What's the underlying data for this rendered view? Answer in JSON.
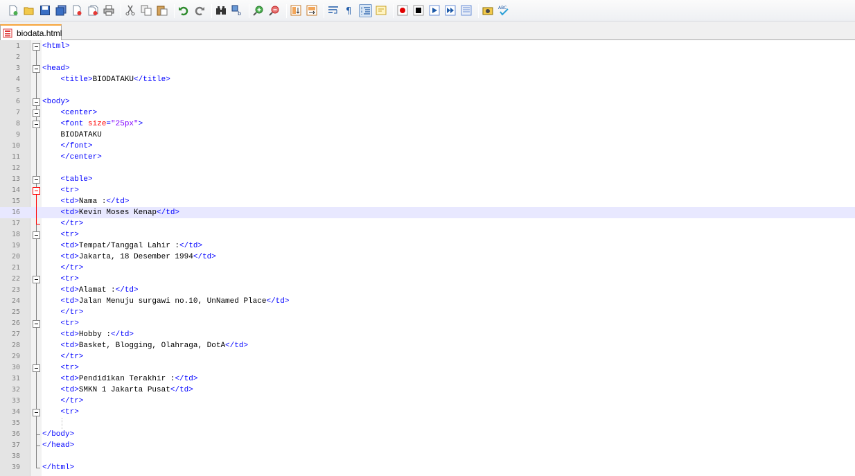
{
  "toolbar": {
    "buttons": [
      {
        "name": "new-file-icon"
      },
      {
        "name": "open-file-icon"
      },
      {
        "name": "save-icon"
      },
      {
        "name": "save-all-icon"
      },
      {
        "name": "close-icon"
      },
      {
        "name": "close-all-icon"
      },
      {
        "name": "print-icon"
      },
      {
        "name": "cut-icon"
      },
      {
        "name": "copy-icon"
      },
      {
        "name": "paste-icon"
      },
      {
        "name": "undo-icon"
      },
      {
        "name": "redo-icon"
      },
      {
        "name": "find-icon"
      },
      {
        "name": "replace-icon"
      },
      {
        "name": "zoom-in-icon"
      },
      {
        "name": "zoom-out-icon"
      },
      {
        "name": "sync-vertical-icon"
      },
      {
        "name": "sync-horizontal-icon"
      },
      {
        "name": "word-wrap-icon"
      },
      {
        "name": "show-all-characters-icon"
      },
      {
        "name": "indent-guide-icon",
        "active": true
      },
      {
        "name": "user-language-icon"
      },
      {
        "name": "record-macro-icon"
      },
      {
        "name": "stop-recording-icon"
      },
      {
        "name": "play-macro-icon"
      },
      {
        "name": "run-macro-multiple-icon"
      },
      {
        "name": "save-macro-icon"
      },
      {
        "name": "launch-browser-icon"
      },
      {
        "name": "spell-check-icon",
        "label": "ABC"
      }
    ]
  },
  "tab": {
    "label": "biodata.html",
    "icon": "unsaved-file-icon"
  },
  "colors": {
    "tag": "#0000ff",
    "attribute": "#ff0000",
    "value": "#8000ff",
    "text": "#000000",
    "current_line": "#e8e8ff",
    "tab_accent": "#f7a53a"
  },
  "editor": {
    "current_line": 16,
    "lines": [
      {
        "n": "1",
        "parts": [
          [
            "tag",
            "<html>"
          ]
        ]
      },
      {
        "n": "2",
        "parts": []
      },
      {
        "n": "3",
        "parts": [
          [
            "tag",
            "<head>"
          ]
        ]
      },
      {
        "n": "4",
        "parts": [
          [
            "txt",
            "    "
          ],
          [
            "tag",
            "<title>"
          ],
          [
            "txt",
            "BIODATAKU"
          ],
          [
            "tag",
            "</title>"
          ]
        ]
      },
      {
        "n": "5",
        "parts": []
      },
      {
        "n": "6",
        "parts": [
          [
            "tag",
            "<body>"
          ]
        ]
      },
      {
        "n": "7",
        "parts": [
          [
            "txt",
            "    "
          ],
          [
            "tag",
            "<center>"
          ]
        ]
      },
      {
        "n": "8",
        "parts": [
          [
            "txt",
            "    "
          ],
          [
            "tag",
            "<font "
          ],
          [
            "attr",
            "size"
          ],
          [
            "tag",
            "="
          ],
          [
            "val",
            "\"25px\""
          ],
          [
            "tag",
            ">"
          ]
        ]
      },
      {
        "n": "9",
        "parts": [
          [
            "txt",
            "    BIODATAKU"
          ]
        ]
      },
      {
        "n": "10",
        "parts": [
          [
            "txt",
            "    "
          ],
          [
            "tag",
            "</font>"
          ]
        ]
      },
      {
        "n": "11",
        "parts": [
          [
            "txt",
            "    "
          ],
          [
            "tag",
            "</center>"
          ]
        ]
      },
      {
        "n": "12",
        "parts": []
      },
      {
        "n": "13",
        "parts": [
          [
            "txt",
            "    "
          ],
          [
            "tag",
            "<table>"
          ]
        ]
      },
      {
        "n": "14",
        "parts": [
          [
            "txt",
            "    "
          ],
          [
            "tag",
            "<tr>"
          ]
        ]
      },
      {
        "n": "15",
        "parts": [
          [
            "txt",
            "    "
          ],
          [
            "tag",
            "<td>"
          ],
          [
            "txt",
            "Nama :"
          ],
          [
            "tag",
            "</td>"
          ]
        ]
      },
      {
        "n": "16",
        "parts": [
          [
            "txt",
            "    "
          ],
          [
            "tag",
            "<td>"
          ],
          [
            "txt",
            "Kevin Moses Kenap"
          ],
          [
            "tag",
            "</td>"
          ]
        ]
      },
      {
        "n": "17",
        "parts": [
          [
            "txt",
            "    "
          ],
          [
            "tag",
            "</tr>"
          ]
        ]
      },
      {
        "n": "18",
        "parts": [
          [
            "txt",
            "    "
          ],
          [
            "tag",
            "<tr>"
          ]
        ]
      },
      {
        "n": "19",
        "parts": [
          [
            "txt",
            "    "
          ],
          [
            "tag",
            "<td>"
          ],
          [
            "txt",
            "Tempat/Tanggal Lahir :"
          ],
          [
            "tag",
            "</td>"
          ]
        ]
      },
      {
        "n": "20",
        "parts": [
          [
            "txt",
            "    "
          ],
          [
            "tag",
            "<td>"
          ],
          [
            "txt",
            "Jakarta, 18 Desember 1994"
          ],
          [
            "tag",
            "</td>"
          ]
        ]
      },
      {
        "n": "21",
        "parts": [
          [
            "txt",
            "    "
          ],
          [
            "tag",
            "</tr>"
          ]
        ]
      },
      {
        "n": "22",
        "parts": [
          [
            "txt",
            "    "
          ],
          [
            "tag",
            "<tr>"
          ]
        ]
      },
      {
        "n": "23",
        "parts": [
          [
            "txt",
            "    "
          ],
          [
            "tag",
            "<td>"
          ],
          [
            "txt",
            "Alamat :"
          ],
          [
            "tag",
            "</td>"
          ]
        ]
      },
      {
        "n": "24",
        "parts": [
          [
            "txt",
            "    "
          ],
          [
            "tag",
            "<td>"
          ],
          [
            "txt",
            "Jalan Menuju surgawi no.10, UnNamed Place"
          ],
          [
            "tag",
            "</td>"
          ]
        ]
      },
      {
        "n": "25",
        "parts": [
          [
            "txt",
            "    "
          ],
          [
            "tag",
            "</tr>"
          ]
        ]
      },
      {
        "n": "26",
        "parts": [
          [
            "txt",
            "    "
          ],
          [
            "tag",
            "<tr>"
          ]
        ]
      },
      {
        "n": "27",
        "parts": [
          [
            "txt",
            "    "
          ],
          [
            "tag",
            "<td>"
          ],
          [
            "txt",
            "Hobby :"
          ],
          [
            "tag",
            "</td>"
          ]
        ]
      },
      {
        "n": "28",
        "parts": [
          [
            "txt",
            "    "
          ],
          [
            "tag",
            "<td>"
          ],
          [
            "txt",
            "Basket, Blogging, Olahraga, DotA"
          ],
          [
            "tag",
            "</td>"
          ]
        ]
      },
      {
        "n": "29",
        "parts": [
          [
            "txt",
            "    "
          ],
          [
            "tag",
            "</tr>"
          ]
        ]
      },
      {
        "n": "30",
        "parts": [
          [
            "txt",
            "    "
          ],
          [
            "tag",
            "<tr>"
          ]
        ]
      },
      {
        "n": "31",
        "parts": [
          [
            "txt",
            "    "
          ],
          [
            "tag",
            "<td>"
          ],
          [
            "txt",
            "Pendidikan Terakhir :"
          ],
          [
            "tag",
            "</td>"
          ]
        ]
      },
      {
        "n": "32",
        "parts": [
          [
            "txt",
            "    "
          ],
          [
            "tag",
            "<td>"
          ],
          [
            "txt",
            "SMKN 1 Jakarta Pusat"
          ],
          [
            "tag",
            "</td>"
          ]
        ]
      },
      {
        "n": "33",
        "parts": [
          [
            "txt",
            "    "
          ],
          [
            "tag",
            "</tr>"
          ]
        ]
      },
      {
        "n": "34",
        "parts": [
          [
            "txt",
            "    "
          ],
          [
            "tag",
            "<tr>"
          ]
        ]
      },
      {
        "n": "35",
        "parts": []
      },
      {
        "n": "36",
        "parts": [
          [
            "tag",
            "</body>"
          ]
        ]
      },
      {
        "n": "37",
        "parts": [
          [
            "tag",
            "</head>"
          ]
        ]
      },
      {
        "n": "38",
        "parts": []
      },
      {
        "n": "39",
        "parts": [
          [
            "tag",
            "</html>"
          ]
        ]
      }
    ]
  }
}
